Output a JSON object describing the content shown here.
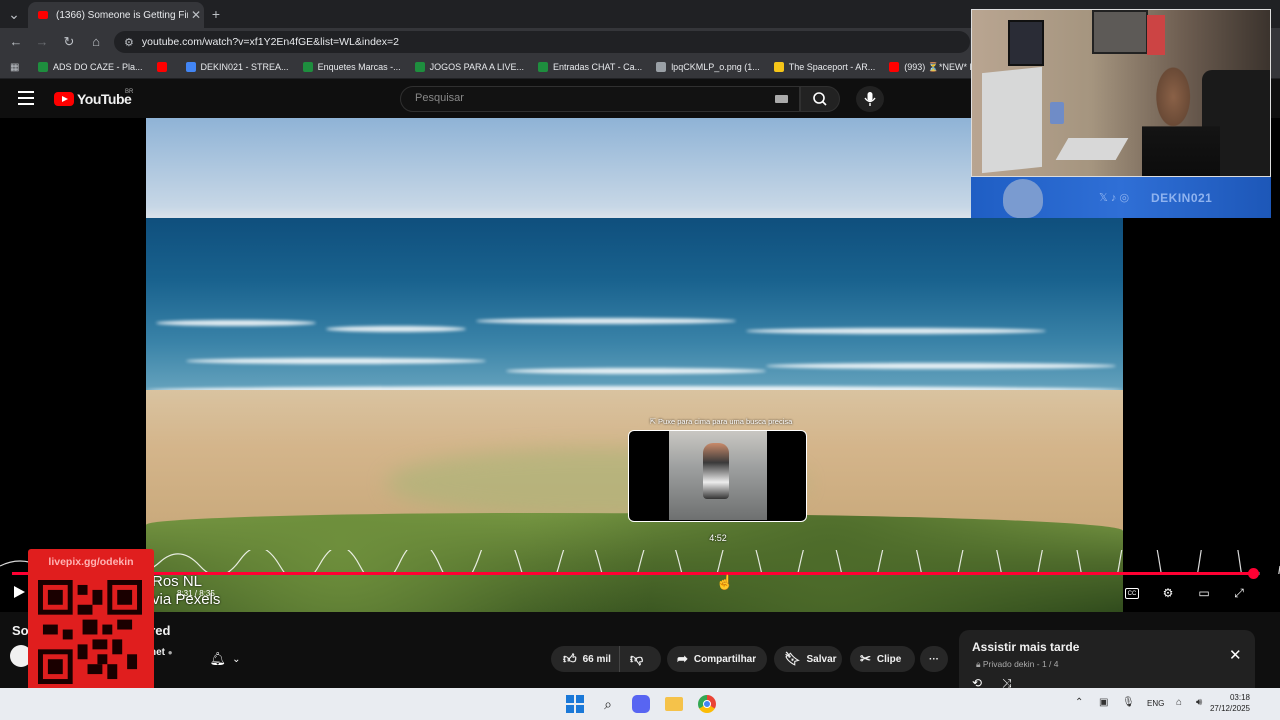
{
  "browser": {
    "tab_title": "(1366) Someone is Getting Fire",
    "url": "youtube.com/watch?v=xf1Y2En4fGE&list=WL&index=2",
    "bookmarks": [
      {
        "label": "ADS DO CAZE - Pla...",
        "color": "#1e8e3e"
      },
      {
        "label": "",
        "color": "#ff0000"
      },
      {
        "label": "DEKIN021 - STREA...",
        "color": "#4285f4"
      },
      {
        "label": "Enquetes Marcas -...",
        "color": "#1e8e3e"
      },
      {
        "label": "JOGOS PARA A LIVE...",
        "color": "#1e8e3e"
      },
      {
        "label": "Entradas CHAT - Ca...",
        "color": "#1e8e3e"
      },
      {
        "label": "lpqCKMLP_o.png (1...",
        "color": "#9aa0a6"
      },
      {
        "label": "The Spaceport - AR...",
        "color": "#f5c518"
      },
      {
        "label": "(993) ⏳*NEW* EXA...",
        "color": "#ff0000"
      }
    ]
  },
  "youtube": {
    "logo_text": "YouTube",
    "country_code": "BR",
    "search_placeholder": "Pesquisar"
  },
  "player": {
    "preview_hint": "⇱ Puxe para cima para uma busca precisa",
    "preview_time": "4:52",
    "time_display": "8:31 / 8:35",
    "progress_fraction": 0.994,
    "overlay_line1": "Ros NL",
    "overlay_line2": "via Pexels",
    "accent_color": "#ff0033"
  },
  "video_info": {
    "title_visible_start": "So",
    "title_visible_end": "ired",
    "channel_fragment": "net",
    "like_count": "66 mil",
    "share_label": "Compartilhar",
    "save_label": "Salvar",
    "clip_label": "Clipe",
    "more_label": "···"
  },
  "playlist": {
    "title": "Assistir mais tarde",
    "subtitle": "Privado dekin - 1 / 4"
  },
  "stream_overlay": {
    "livepix_url": "livepix.gg/odekin",
    "social_handle": "DEKIN021"
  },
  "taskbar": {
    "language": "ENG",
    "time": "03:18",
    "date": "27/12/2025"
  }
}
